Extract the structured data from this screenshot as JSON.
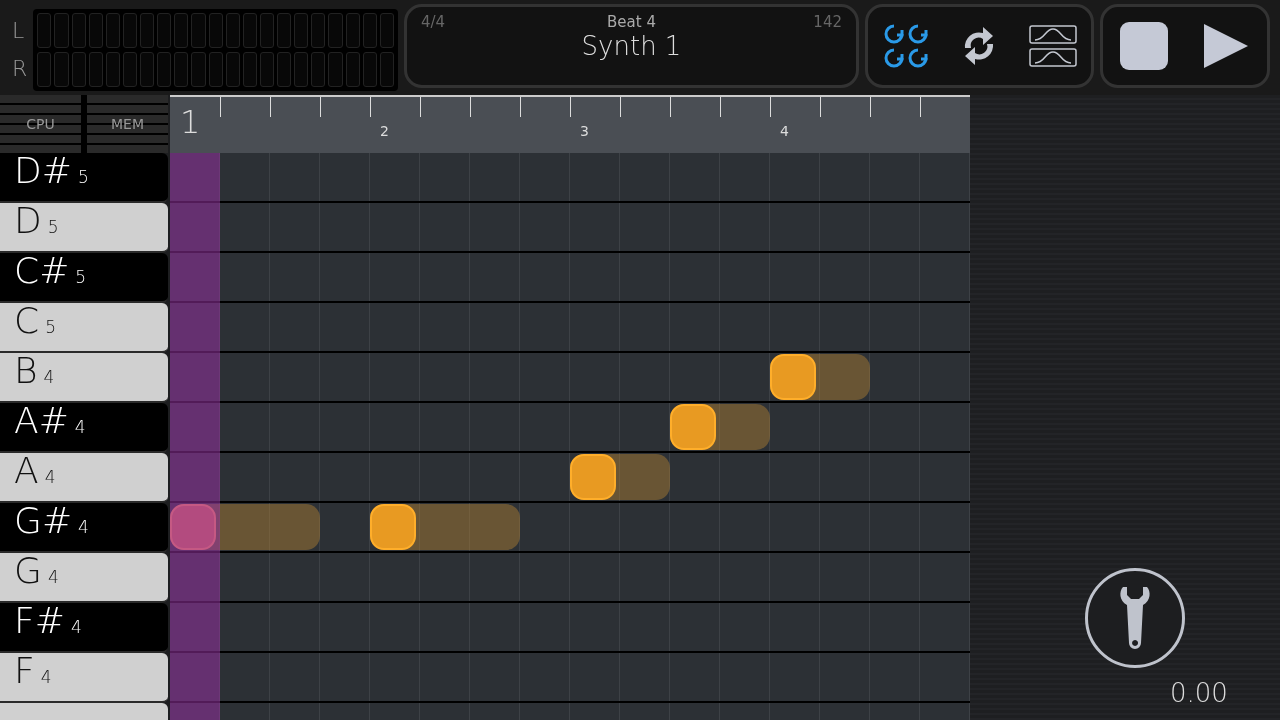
{
  "meters": [
    {
      "label": "L",
      "level": 0
    },
    {
      "label": "R",
      "level": 0
    }
  ],
  "info": {
    "time_signature": "4/4",
    "beat": "Beat 4",
    "track": "Synth 1",
    "tempo": "142"
  },
  "toggles": [
    {
      "kind": "loop-all",
      "on": true
    },
    {
      "kind": "loop",
      "on": false
    },
    {
      "kind": "waves",
      "on": false
    }
  ],
  "transport": [
    {
      "kind": "stop"
    },
    {
      "kind": "play"
    }
  ],
  "monitors": [
    {
      "label": "CPU"
    },
    {
      "label": "MEM"
    }
  ],
  "ruler": {
    "beats": [
      "1",
      "2",
      "3",
      "4"
    ]
  },
  "playhead": {
    "level": 0
  },
  "rows": [
    {
      "kind": "black",
      "note": "D#",
      "octave": "5"
    },
    {
      "kind": "white",
      "note": "D",
      "octave": "5"
    },
    {
      "kind": "black",
      "note": "C#",
      "octave": "5"
    },
    {
      "kind": "white",
      "note": "C",
      "octave": "5"
    },
    {
      "kind": "white",
      "note": "B",
      "octave": "4",
      "cells": [
        {
          "kind": "empty"
        },
        {
          "kind": "empty"
        },
        {
          "kind": "empty"
        },
        {
          "kind": "empty"
        },
        {
          "kind": "empty"
        },
        {
          "kind": "empty"
        },
        {
          "kind": "empty"
        },
        {
          "kind": "empty"
        },
        {
          "kind": "empty"
        },
        {
          "kind": "empty"
        },
        {
          "kind": "empty"
        },
        {
          "kind": "empty"
        },
        {
          "kind": "note",
          "playing": false
        },
        {
          "kind": "hold"
        },
        {
          "kind": "empty"
        },
        {
          "kind": "empty"
        }
      ]
    },
    {
      "kind": "black",
      "note": "A#",
      "octave": "4",
      "cells": [
        {
          "kind": "empty"
        },
        {
          "kind": "empty"
        },
        {
          "kind": "empty"
        },
        {
          "kind": "empty"
        },
        {
          "kind": "empty"
        },
        {
          "kind": "empty"
        },
        {
          "kind": "empty"
        },
        {
          "kind": "empty"
        },
        {
          "kind": "empty"
        },
        {
          "kind": "empty"
        },
        {
          "kind": "note",
          "playing": false
        },
        {
          "kind": "hold"
        },
        {
          "kind": "empty"
        },
        {
          "kind": "empty"
        },
        {
          "kind": "empty"
        },
        {
          "kind": "empty"
        }
      ]
    },
    {
      "kind": "white",
      "note": "A",
      "octave": "4",
      "cells": [
        {
          "kind": "empty"
        },
        {
          "kind": "empty"
        },
        {
          "kind": "empty"
        },
        {
          "kind": "empty"
        },
        {
          "kind": "empty"
        },
        {
          "kind": "empty"
        },
        {
          "kind": "empty"
        },
        {
          "kind": "empty"
        },
        {
          "kind": "note",
          "playing": false
        },
        {
          "kind": "hold"
        },
        {
          "kind": "empty"
        },
        {
          "kind": "empty"
        },
        {
          "kind": "empty"
        },
        {
          "kind": "empty"
        },
        {
          "kind": "empty"
        },
        {
          "kind": "empty"
        }
      ]
    },
    {
      "kind": "black",
      "note": "G#",
      "octave": "4",
      "cells": [
        {
          "kind": "note",
          "playing": true
        },
        {
          "kind": "hold"
        },
        {
          "kind": "hold"
        },
        {
          "kind": "empty"
        },
        {
          "kind": "note",
          "playing": false
        },
        {
          "kind": "hold"
        },
        {
          "kind": "hold"
        },
        {
          "kind": "empty"
        },
        {
          "kind": "empty"
        },
        {
          "kind": "empty"
        },
        {
          "kind": "empty"
        },
        {
          "kind": "empty"
        },
        {
          "kind": "empty"
        },
        {
          "kind": "empty"
        },
        {
          "kind": "empty"
        },
        {
          "kind": "empty"
        }
      ]
    },
    {
      "kind": "white",
      "note": "G",
      "octave": "4"
    },
    {
      "kind": "black",
      "note": "F#",
      "octave": "4"
    },
    {
      "kind": "white",
      "note": "F",
      "octave": "4"
    },
    {
      "kind": "white"
    }
  ],
  "settings": {
    "value": "0.00"
  }
}
